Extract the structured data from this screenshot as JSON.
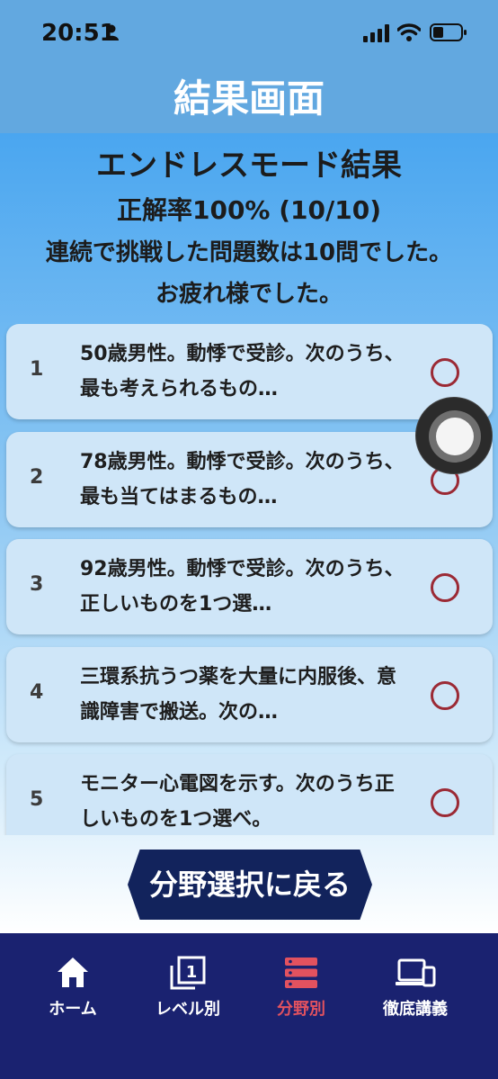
{
  "status_bar": {
    "time": "20:51"
  },
  "header": {
    "title": "結果画面"
  },
  "result": {
    "heading": "エンドレスモード結果",
    "accuracy": "正解率100% (10/10)",
    "summary_line1": "連続で挑戦した問題数は10問でした。",
    "summary_line2": "お疲れ様でした。"
  },
  "questions": [
    {
      "number": "1",
      "text": "50歳男性。動悸で受診。次のうち、最も考えられるもの…",
      "mark": "○"
    },
    {
      "number": "2",
      "text": "78歳男性。動悸で受診。次のうち、最も当てはまるもの…",
      "mark": "○"
    },
    {
      "number": "3",
      "text": "92歳男性。動悸で受診。次のうち、正しいものを1つ選…",
      "mark": "○"
    },
    {
      "number": "4",
      "text": "三環系抗うつ薬を大量に内服後、意識障害で搬送。次の…",
      "mark": "○"
    },
    {
      "number": "5",
      "text": "モニター心電図を示す。次のうち正しいものを1つ選べ。",
      "mark": "○"
    }
  ],
  "back_button": {
    "label": "分野選択に戻る"
  },
  "tabs": [
    {
      "label": "ホーム",
      "icon": "home-icon",
      "active": false
    },
    {
      "label": "レベル別",
      "icon": "level-icon",
      "active": false
    },
    {
      "label": "分野別",
      "icon": "category-icon",
      "active": true
    },
    {
      "label": "徹底講義",
      "icon": "devices-icon",
      "active": false
    }
  ],
  "colors": {
    "header": "#62a8e0",
    "tab_bar": "#1a2270",
    "active_tab": "#e2525f",
    "correct_mark": "#9b2a35",
    "back_button": "#12235c"
  }
}
